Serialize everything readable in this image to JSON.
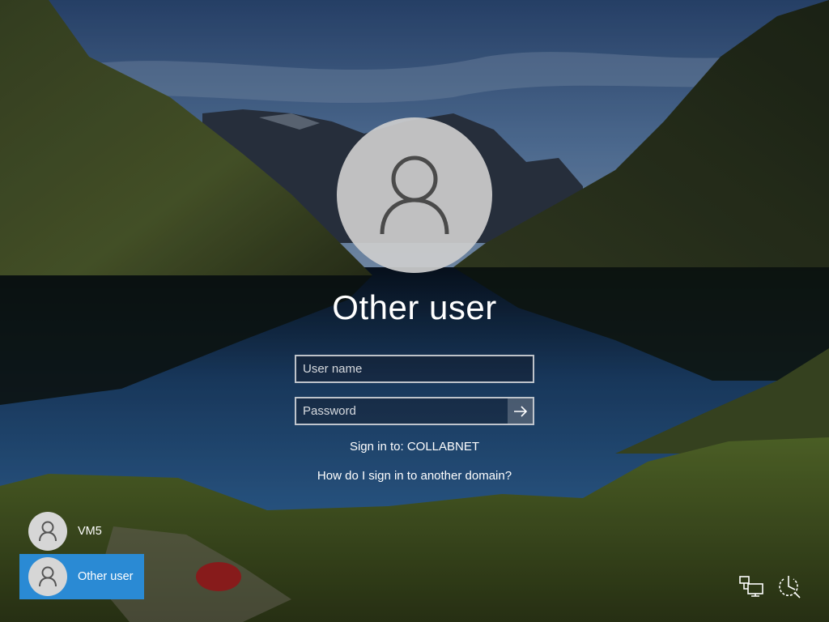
{
  "login": {
    "title": "Other user",
    "username_placeholder": "User name",
    "password_placeholder": "Password",
    "signin_to": "Sign in to: COLLABNET",
    "domain_link": "How do I sign in to another domain?"
  },
  "users": [
    {
      "name": "VM5",
      "selected": false
    },
    {
      "name": "Other user",
      "selected": true
    }
  ],
  "colors": {
    "accent": "#2a8ad4"
  },
  "icons": {
    "avatar": "user-icon",
    "submit": "arrow-right-icon",
    "network": "network-icon",
    "power": "power-icon"
  }
}
